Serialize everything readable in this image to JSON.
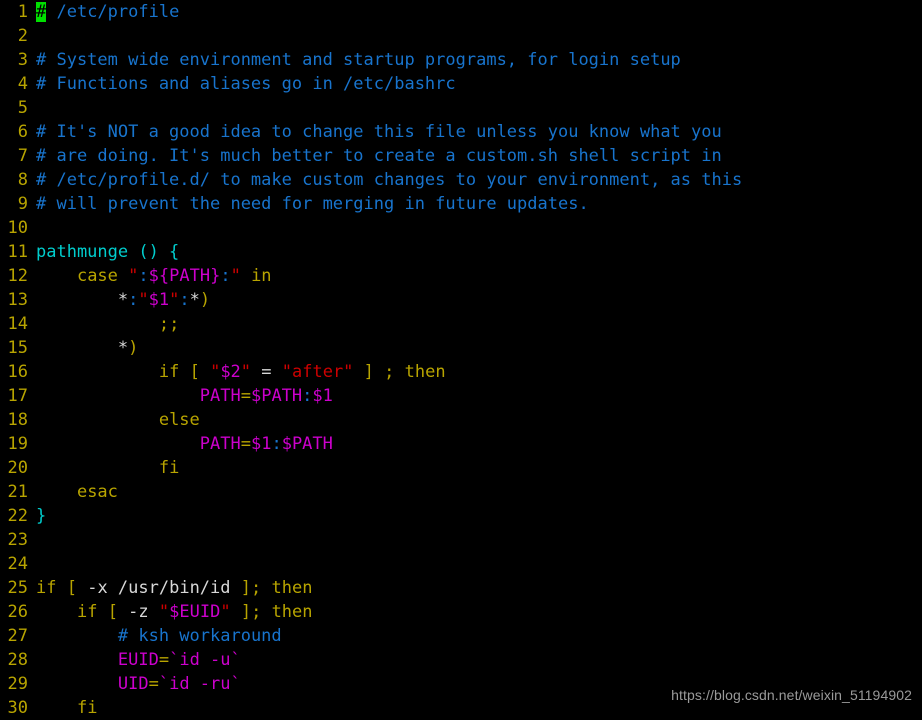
{
  "editor": {
    "app": "vim",
    "filename": "/etc/profile",
    "background_color": "#000000",
    "cursor": {
      "line": 1,
      "column": 1,
      "char": "#",
      "color": "#00e000",
      "text_color": "#000000"
    },
    "colors": {
      "line_number": "#b8a400",
      "comment": "#1874cd",
      "keyword": "#b8a400",
      "function": "#00cdcd",
      "string": "#cd0000",
      "variable": "#cd00cd",
      "operator": "#b8a400",
      "delimiter": "#1874cd",
      "plain": "#d8d8d8"
    },
    "lines": [
      {
        "number": "1",
        "tokens": [
          {
            "t": "#",
            "c": "cursor"
          },
          {
            "t": " /etc/profile",
            "c": "c-comment"
          }
        ]
      },
      {
        "number": "2",
        "tokens": []
      },
      {
        "number": "3",
        "tokens": [
          {
            "t": "# System wide environment and startup programs, for login setup",
            "c": "c-comment"
          }
        ]
      },
      {
        "number": "4",
        "tokens": [
          {
            "t": "# Functions and aliases go in /etc/bashrc",
            "c": "c-comment"
          }
        ]
      },
      {
        "number": "5",
        "tokens": []
      },
      {
        "number": "6",
        "tokens": [
          {
            "t": "# It's NOT a good idea to change this file unless you know what you",
            "c": "c-comment"
          }
        ]
      },
      {
        "number": "7",
        "tokens": [
          {
            "t": "# are doing. It's much better to create a custom.sh shell script in",
            "c": "c-comment"
          }
        ]
      },
      {
        "number": "8",
        "tokens": [
          {
            "t": "# /etc/profile.d/ to make custom changes to your environment, as this",
            "c": "c-comment"
          }
        ]
      },
      {
        "number": "9",
        "tokens": [
          {
            "t": "# will prevent the need for merging in future updates.",
            "c": "c-comment"
          }
        ]
      },
      {
        "number": "10",
        "tokens": []
      },
      {
        "number": "11",
        "tokens": [
          {
            "t": "pathmunge () {",
            "c": "c-func"
          }
        ]
      },
      {
        "number": "12",
        "tokens": [
          {
            "t": "    ",
            "c": "c-plain"
          },
          {
            "t": "case",
            "c": "c-keyword"
          },
          {
            "t": " ",
            "c": "c-plain"
          },
          {
            "t": "\"",
            "c": "c-string"
          },
          {
            "t": ":",
            "c": "c-delim"
          },
          {
            "t": "${PATH}",
            "c": "c-var"
          },
          {
            "t": ":",
            "c": "c-delim"
          },
          {
            "t": "\"",
            "c": "c-string"
          },
          {
            "t": " ",
            "c": "c-plain"
          },
          {
            "t": "in",
            "c": "c-keyword"
          }
        ]
      },
      {
        "number": "13",
        "tokens": [
          {
            "t": "        ",
            "c": "c-plain"
          },
          {
            "t": "*",
            "c": "c-plain"
          },
          {
            "t": ":",
            "c": "c-delim"
          },
          {
            "t": "\"",
            "c": "c-string"
          },
          {
            "t": "$1",
            "c": "c-var"
          },
          {
            "t": "\"",
            "c": "c-string"
          },
          {
            "t": ":",
            "c": "c-delim"
          },
          {
            "t": "*",
            "c": "c-plain"
          },
          {
            "t": ")",
            "c": "c-keyword"
          }
        ]
      },
      {
        "number": "14",
        "tokens": [
          {
            "t": "            ",
            "c": "c-plain"
          },
          {
            "t": ";;",
            "c": "c-keyword"
          }
        ]
      },
      {
        "number": "15",
        "tokens": [
          {
            "t": "        ",
            "c": "c-plain"
          },
          {
            "t": "*",
            "c": "c-plain"
          },
          {
            "t": ")",
            "c": "c-keyword"
          }
        ]
      },
      {
        "number": "16",
        "tokens": [
          {
            "t": "            ",
            "c": "c-plain"
          },
          {
            "t": "if",
            "c": "c-keyword"
          },
          {
            "t": " ",
            "c": "c-plain"
          },
          {
            "t": "[",
            "c": "c-keyword"
          },
          {
            "t": " ",
            "c": "c-plain"
          },
          {
            "t": "\"",
            "c": "c-string"
          },
          {
            "t": "$2",
            "c": "c-var"
          },
          {
            "t": "\"",
            "c": "c-string"
          },
          {
            "t": " = ",
            "c": "c-plain"
          },
          {
            "t": "\"after\"",
            "c": "c-string"
          },
          {
            "t": " ",
            "c": "c-plain"
          },
          {
            "t": "]",
            "c": "c-keyword"
          },
          {
            "t": " ",
            "c": "c-plain"
          },
          {
            "t": ";",
            "c": "c-keyword"
          },
          {
            "t": " ",
            "c": "c-plain"
          },
          {
            "t": "then",
            "c": "c-keyword"
          }
        ]
      },
      {
        "number": "17",
        "tokens": [
          {
            "t": "                ",
            "c": "c-plain"
          },
          {
            "t": "PATH",
            "c": "c-var"
          },
          {
            "t": "=",
            "c": "c-op"
          },
          {
            "t": "$PATH",
            "c": "c-var"
          },
          {
            "t": ":",
            "c": "c-delim"
          },
          {
            "t": "$1",
            "c": "c-var"
          }
        ]
      },
      {
        "number": "18",
        "tokens": [
          {
            "t": "            ",
            "c": "c-plain"
          },
          {
            "t": "else",
            "c": "c-keyword"
          }
        ]
      },
      {
        "number": "19",
        "tokens": [
          {
            "t": "                ",
            "c": "c-plain"
          },
          {
            "t": "PATH",
            "c": "c-var"
          },
          {
            "t": "=",
            "c": "c-op"
          },
          {
            "t": "$1",
            "c": "c-var"
          },
          {
            "t": ":",
            "c": "c-delim"
          },
          {
            "t": "$PATH",
            "c": "c-var"
          }
        ]
      },
      {
        "number": "20",
        "tokens": [
          {
            "t": "            ",
            "c": "c-plain"
          },
          {
            "t": "fi",
            "c": "c-keyword"
          }
        ]
      },
      {
        "number": "21",
        "tokens": [
          {
            "t": "    ",
            "c": "c-plain"
          },
          {
            "t": "esac",
            "c": "c-keyword"
          }
        ]
      },
      {
        "number": "22",
        "tokens": [
          {
            "t": "}",
            "c": "c-func"
          }
        ]
      },
      {
        "number": "23",
        "tokens": []
      },
      {
        "number": "24",
        "tokens": []
      },
      {
        "number": "25",
        "tokens": [
          {
            "t": "if",
            "c": "c-keyword"
          },
          {
            "t": " ",
            "c": "c-plain"
          },
          {
            "t": "[",
            "c": "c-keyword"
          },
          {
            "t": " -x /usr/bin/id ",
            "c": "c-plain"
          },
          {
            "t": "];",
            "c": "c-keyword"
          },
          {
            "t": " ",
            "c": "c-plain"
          },
          {
            "t": "then",
            "c": "c-keyword"
          }
        ]
      },
      {
        "number": "26",
        "tokens": [
          {
            "t": "    ",
            "c": "c-plain"
          },
          {
            "t": "if",
            "c": "c-keyword"
          },
          {
            "t": " ",
            "c": "c-plain"
          },
          {
            "t": "[",
            "c": "c-keyword"
          },
          {
            "t": " -z ",
            "c": "c-plain"
          },
          {
            "t": "\"",
            "c": "c-string"
          },
          {
            "t": "$EUID",
            "c": "c-var"
          },
          {
            "t": "\"",
            "c": "c-string"
          },
          {
            "t": " ",
            "c": "c-plain"
          },
          {
            "t": "];",
            "c": "c-keyword"
          },
          {
            "t": " ",
            "c": "c-plain"
          },
          {
            "t": "then",
            "c": "c-keyword"
          }
        ]
      },
      {
        "number": "27",
        "tokens": [
          {
            "t": "        ",
            "c": "c-plain"
          },
          {
            "t": "# ksh workaround",
            "c": "c-comment"
          }
        ]
      },
      {
        "number": "28",
        "tokens": [
          {
            "t": "        ",
            "c": "c-plain"
          },
          {
            "t": "EUID",
            "c": "c-var"
          },
          {
            "t": "=",
            "c": "c-op"
          },
          {
            "t": "`id -u`",
            "c": "c-var"
          }
        ]
      },
      {
        "number": "29",
        "tokens": [
          {
            "t": "        ",
            "c": "c-plain"
          },
          {
            "t": "UID",
            "c": "c-var"
          },
          {
            "t": "=",
            "c": "c-op"
          },
          {
            "t": "`id -ru`",
            "c": "c-var"
          }
        ]
      },
      {
        "number": "30",
        "tokens": [
          {
            "t": "    ",
            "c": "c-plain"
          },
          {
            "t": "fi",
            "c": "c-keyword"
          }
        ]
      }
    ]
  },
  "watermark": {
    "text": "https://blog.csdn.net/weixin_51194902"
  }
}
